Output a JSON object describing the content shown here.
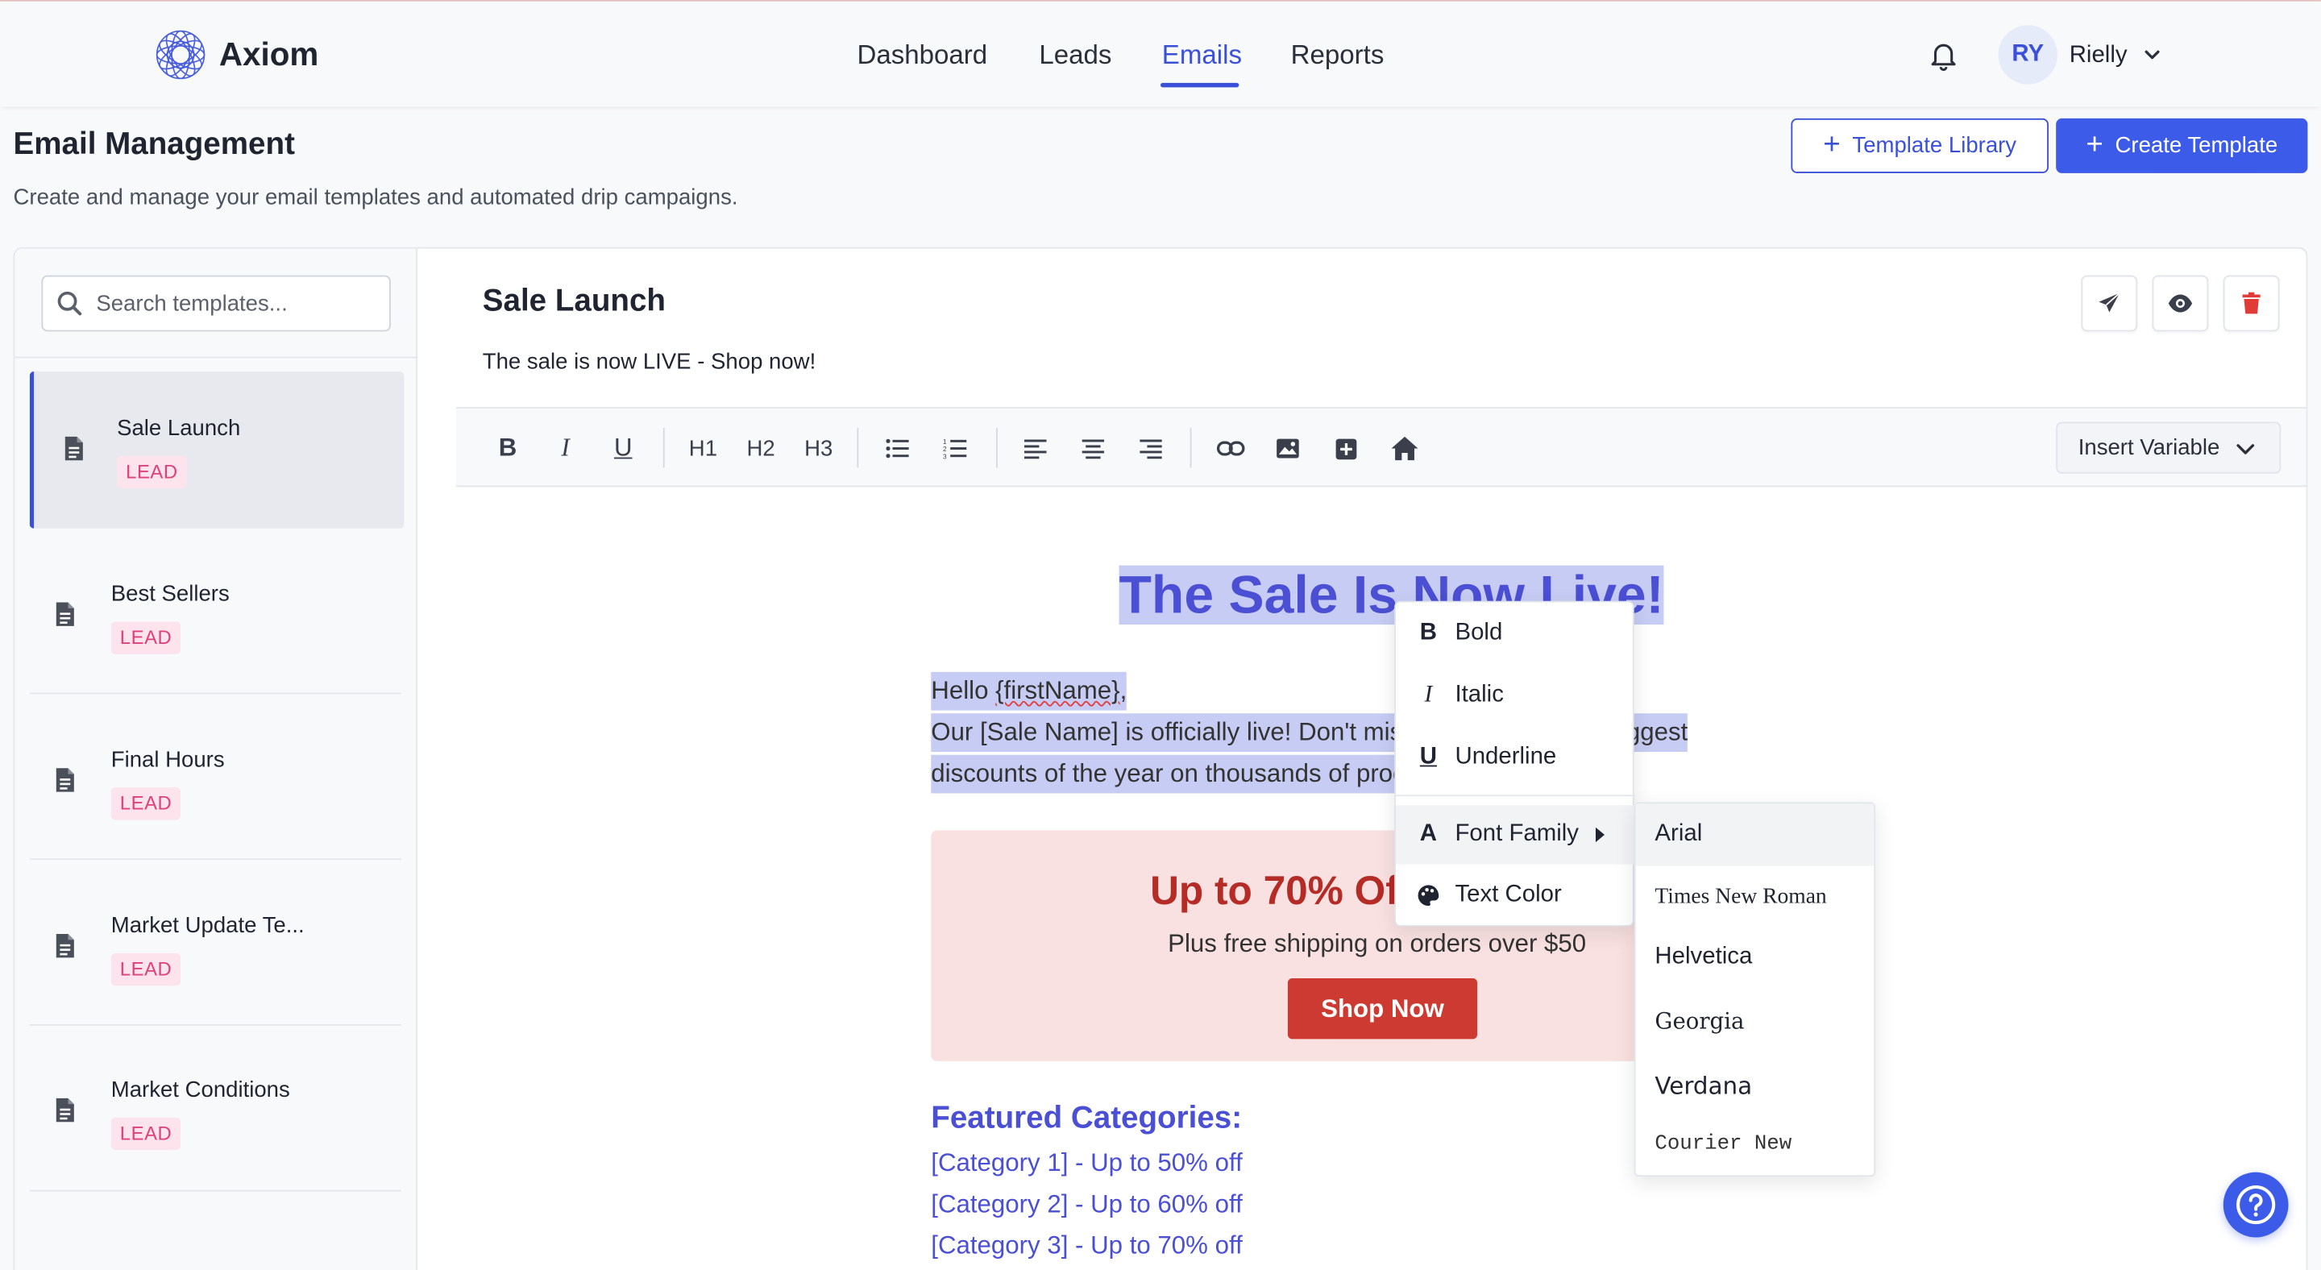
{
  "app": {
    "name": "Axiom"
  },
  "nav": {
    "items": [
      "Dashboard",
      "Leads",
      "Emails",
      "Reports"
    ],
    "active": "Emails"
  },
  "user": {
    "initials": "RY",
    "name": "Rielly"
  },
  "page": {
    "title": "Email Management",
    "subtitle": "Create and manage your email templates and automated drip campaigns.",
    "template_library_label": "Template Library",
    "create_template_label": "Create Template"
  },
  "sidebar": {
    "search_placeholder": "Search templates...",
    "templates": [
      {
        "name": "Sale Launch",
        "badge": "LEAD",
        "active": true
      },
      {
        "name": "Best Sellers",
        "badge": "LEAD"
      },
      {
        "name": "Final Hours",
        "badge": "LEAD"
      },
      {
        "name": "Market Update Te...",
        "badge": "LEAD"
      },
      {
        "name": "Market Conditions",
        "badge": "LEAD"
      }
    ]
  },
  "editor": {
    "title": "Sale Launch",
    "subject": "The sale is now LIVE - Shop now!",
    "toolbar": {
      "h1": "H1",
      "h2": "H2",
      "h3": "H3",
      "insert_variable": "Insert Variable"
    },
    "content": {
      "heading": "The Sale Is Now Live!",
      "greeting_prefix": "Hello ",
      "greeting_var": "{firstName}",
      "greeting_suffix": ",",
      "para_line1": "Our [Sale Name] is officially live! Don't miss out — enjoy our biggest",
      "para_line2": "discounts of the year on thousands of products.",
      "promo_heading": "Up to 70% Off",
      "promo_sub": "Plus free shipping on orders over $50",
      "shop_button": "Shop Now",
      "featured_heading": "Featured Categories:",
      "featured": [
        "[Category 1] - Up to 50% off",
        "[Category 2] - Up to 60% off",
        "[Category 3] - Up to 70% off"
      ]
    }
  },
  "context_menu": {
    "items": [
      "Bold",
      "Italic",
      "Underline",
      "Font Family",
      "Text Color"
    ],
    "font_family_options": [
      "Arial",
      "Times New Roman",
      "Helvetica",
      "Georgia",
      "Verdana",
      "Courier New"
    ],
    "hovered_font": "Arial"
  },
  "colors": {
    "accent": "#3b50d9",
    "primary_button": "#3b5be8",
    "badge_text": "#e0407a",
    "danger": "#e03b36"
  }
}
